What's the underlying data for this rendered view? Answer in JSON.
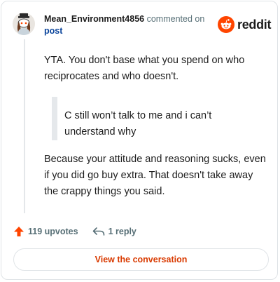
{
  "header": {
    "username": "Mean_Environment4856",
    "commented_on": "commented on",
    "post_link": "post",
    "avatar_icon": "snoo-avatar-icon",
    "logo_text": "reddit",
    "logo_icon": "reddit-snoo-icon"
  },
  "comment": {
    "paragraph_1": "YTA. You don't base what you spend on who reciprocates and who doesn't.",
    "quote": "C still won’t talk to me and i can’t understand why",
    "paragraph_2": "Because your attitude and reasoning sucks, even if you did go buy extra. That doesn't take away the crappy things you said."
  },
  "actions": {
    "upvotes": "119 upvotes",
    "replies": "1 reply",
    "upvote_icon": "upvote-arrow-icon",
    "reply_icon": "reply-arrow-icon"
  },
  "cta": {
    "label": "View the conversation"
  },
  "colors": {
    "brand": "#ff4500",
    "link": "#0a449b",
    "cta_text": "#d93a00",
    "muted": "#576f76"
  }
}
